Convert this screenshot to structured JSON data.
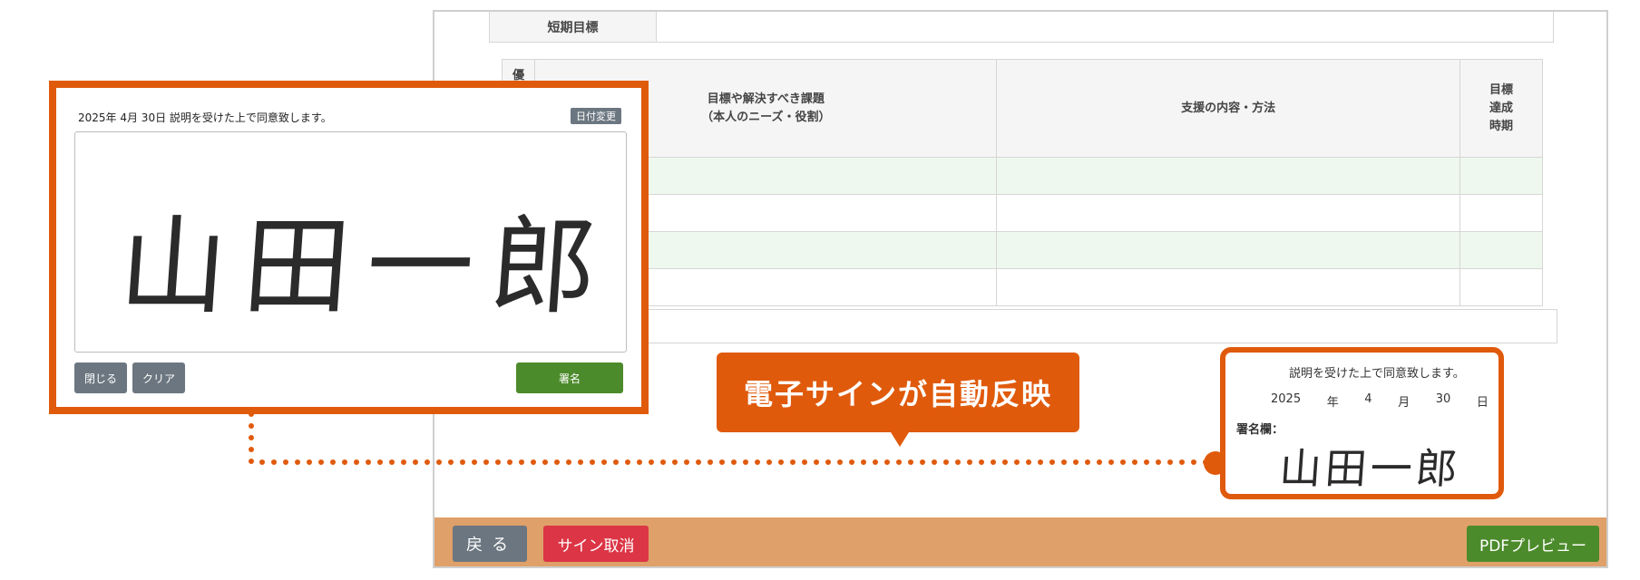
{
  "document": {
    "short_term_goal_label": "短期目標",
    "table_headers": {
      "priority": "優",
      "goals": "目標や解決すべき課題\n（本人のニーズ・役割）",
      "support": "支援の内容・方法",
      "timing": "目標\n達成\n時期"
    }
  },
  "footer": {
    "back_label": "戻る",
    "cancel_sign_label": "サイン取消",
    "pdf_preview_label": "PDFプレビュー"
  },
  "signature_result": {
    "consent_text": "説明を受けた上で同意致します。",
    "year": "2025",
    "year_unit": "年",
    "month": "4",
    "month_unit": "月",
    "day": "30",
    "day_unit": "日",
    "field_label": "署名欄：",
    "signature": "山田一郎"
  },
  "callout": {
    "text": "電子サインが自動反映"
  },
  "sign_dialog": {
    "consent_text": "2025年 4月 30日 説明を受けた上で同意致します。",
    "date_change_label": "日付変更",
    "signature": "山田一郎",
    "close_label": "閉じる",
    "clear_label": "クリア",
    "sign_label": "署名"
  },
  "colors": {
    "accent_orange": "#e05a0c",
    "footer_bar": "#dfa069",
    "green_button": "#4c8b2b",
    "red_button": "#dc3545",
    "gray_button": "#6b7680"
  }
}
